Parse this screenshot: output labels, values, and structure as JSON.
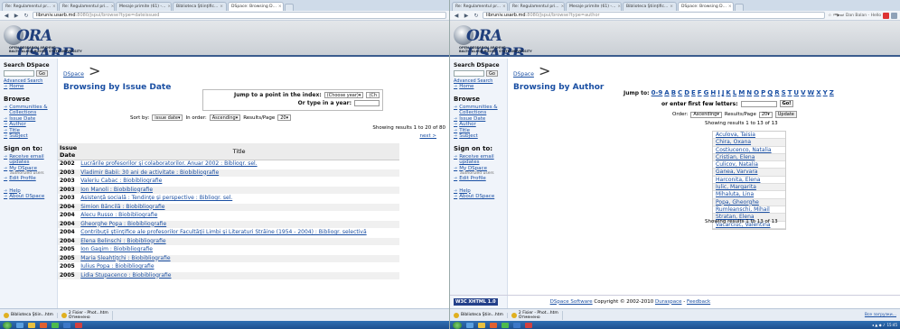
{
  "left": {
    "tabs": [
      "Re: Regulamentul pr...",
      "Re: Regulamentul pri...",
      "Mesaje primite (61) -...",
      "Biblioteca Ştiinţific...",
      "DSpace: Browsing D..."
    ],
    "url_host": "libruniv.usarb.md",
    "url_path": ":8080/jspui/browse?type=dateissued",
    "logo_word": "ORA USARB",
    "logo_sub1": "OPEN RESEARCH ARCHIVE",
    "logo_sub2": "BALTI \"ALECU RUSSO\" STATE UNIVERSITY",
    "sidebar": {
      "search_title": "Search DSpace",
      "go": "Go",
      "advanced": "Advanced Search",
      "home": "Home",
      "browse_title": "Browse",
      "browse_items": [
        "Communities & Collections",
        "Issue Date",
        "Author",
        "Title",
        "Subject"
      ],
      "signon_title": "Sign on to:",
      "receive": "Receive email updates",
      "mydspace": "My DSpace",
      "mydspace_sub": "authorized users",
      "edit": "Edit Profile",
      "help": "Help",
      "about": "About DSpace"
    },
    "breadcrumb": "DSpace",
    "title": "Browsing by Issue Date",
    "jump_label": "Jump to a point in the index:",
    "jump_select": "(Choose year)",
    "jump_select2": "(Ch",
    "type_year": "Or type in a year:",
    "sort_by": "Sort by:",
    "sort_value": "issue date",
    "in_order": "In order:",
    "order_value": "Ascending",
    "rpp": "Results/Page",
    "rpp_value": "20",
    "showing": "Showing results 1 to 20 of 80",
    "next": "next >",
    "col_date": "Issue Date",
    "col_title": "Title",
    "rows": [
      {
        "y": "2002",
        "t": "Lucrările profesorilor şi colaboratorilor. Anuar 2002 : Bibliogr. sel."
      },
      {
        "y": "2003",
        "t": "Vladimir Babii: 30 ani de activitate : Biobibliografie"
      },
      {
        "y": "2003",
        "t": "Valeriu Cabac : Biobibliografie"
      },
      {
        "y": "2003",
        "t": "Ion Manoli : Biobibliografie"
      },
      {
        "y": "2003",
        "t": "Asistenţă socială : Tendinţe şi perspective : Bibliogr. sel."
      },
      {
        "y": "2004",
        "t": "Simion Băncilă : Biobibliografie"
      },
      {
        "y": "2004",
        "t": "Alecu Russo : Biobibliografie"
      },
      {
        "y": "2004",
        "t": "Gheorghe Popa : Biobibliografie"
      },
      {
        "y": "2004",
        "t": "Contribuţii ştiinţifice ale profesorilor Facultăţii Limbi şi Literaturi Străine (1954 - 2004) : Bibliogr. selectivă"
      },
      {
        "y": "2004",
        "t": "Elena Belinschi : Biobibliografie"
      },
      {
        "y": "2005",
        "t": "Ion Gagim : Biobibliografie"
      },
      {
        "y": "2005",
        "t": "Maria Sleahtiţchi : Biobibliografie"
      },
      {
        "y": "2005",
        "t": "Iulius Popa : Biobibliografie"
      },
      {
        "y": "2005",
        "t": "Lidia Stupacenco : Biobibliografie"
      }
    ],
    "downloads": [
      {
        "name": "Biblioteca Ştiin...htm"
      },
      {
        "name": "2 Fisier - Phot...htm",
        "status": "Отменено"
      }
    ]
  },
  "right": {
    "tabs": [
      "Re: Regulamentul pr...",
      "Re: Regulamentul pri...",
      "Mesaje primite (61) -...",
      "Biblioteca Ştiinţific...",
      "DSpace: Browsing D..."
    ],
    "url_host": "libruniv.usarb.md",
    "url_path": ":8080/jspui/browse?type=author",
    "toolbar_right": "Dan Balan - Hello",
    "breadcrumb": "DSpace",
    "title": "Browsing by Author",
    "jump_to": "Jump to:",
    "letters": [
      "0-9",
      "A",
      "B",
      "C",
      "D",
      "E",
      "F",
      "G",
      "H",
      "I",
      "J",
      "K",
      "L",
      "M",
      "N",
      "O",
      "P",
      "Q",
      "R",
      "S",
      "T",
      "U",
      "V",
      "W",
      "X",
      "Y",
      "Z"
    ],
    "enter_letters": "or enter first few letters:",
    "go": "Go!",
    "order": "Order:",
    "order_value": "Ascending",
    "rpp": "Results/Page",
    "rpp_value": "20",
    "update": "Update",
    "showing": "Showing results 1 to 13 of 13",
    "authors": [
      "Aculova, Taisia",
      "Chira, Oxana",
      "Costiucenco, Natalia",
      "Cristian, Elena",
      "Culicov, Natalia",
      "Ganea, Varvara",
      "Harconita, Elena",
      "Iulic, Margarita",
      "Mihaluta, Lina",
      "Popa, Gheorghe",
      "Rumleanschi, Mihail",
      "Stratan, Elena",
      "Vacarciuc, Valentina"
    ],
    "footer_software": "DSpace Software",
    "footer_copy": "Copyright © 2002-2010",
    "footer_duraspace": "Duraspace",
    "footer_feedback": "Feedback",
    "w3c": "W3C XHTML 1.0",
    "downloads": [
      {
        "name": "Biblioteca Ştiin...htm"
      },
      {
        "name": "2 Fisier - Phot...htm",
        "status": "Отменено"
      }
    ],
    "show_all": "Все загрузки...",
    "tray_time": "15:45"
  }
}
